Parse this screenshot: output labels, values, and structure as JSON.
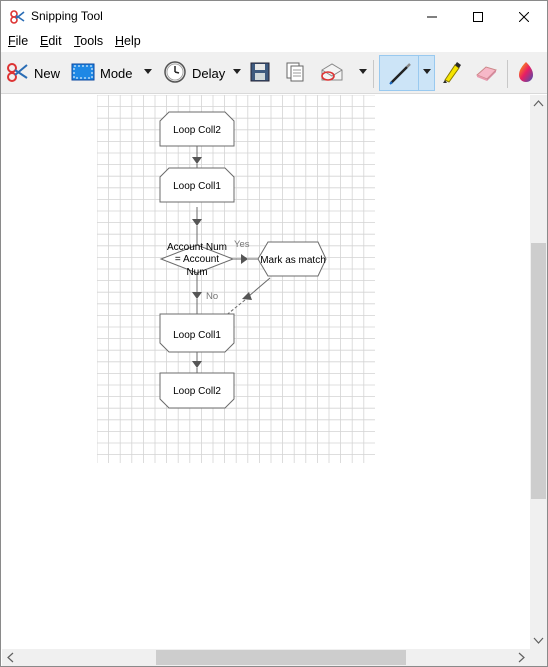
{
  "window": {
    "title": "Snipping Tool"
  },
  "menu": {
    "file": "File",
    "edit": "Edit",
    "tools": "Tools",
    "help": "Help"
  },
  "toolbar": {
    "new_label": "New",
    "mode_label": "Mode",
    "delay_label": "Delay",
    "selected_tool": "pen"
  },
  "flowchart": {
    "nodes": [
      {
        "id": "n1",
        "label": "Loop Coll2"
      },
      {
        "id": "n2",
        "label": "Loop Coll1"
      },
      {
        "id": "n3",
        "label_lines": [
          "Account Num",
          "= Account",
          "Num"
        ]
      },
      {
        "id": "n4",
        "label": "Mark as match"
      },
      {
        "id": "n5",
        "label": "Loop Coll1"
      },
      {
        "id": "n6",
        "label": "Loop Coll2"
      }
    ],
    "edge_labels": {
      "yes": "Yes",
      "no": "No"
    }
  },
  "colors": {
    "accent_selected": "#cce4f7",
    "grid": "#d4d4d4",
    "node_border": "#6b6b6b",
    "arrow": "#555555"
  }
}
